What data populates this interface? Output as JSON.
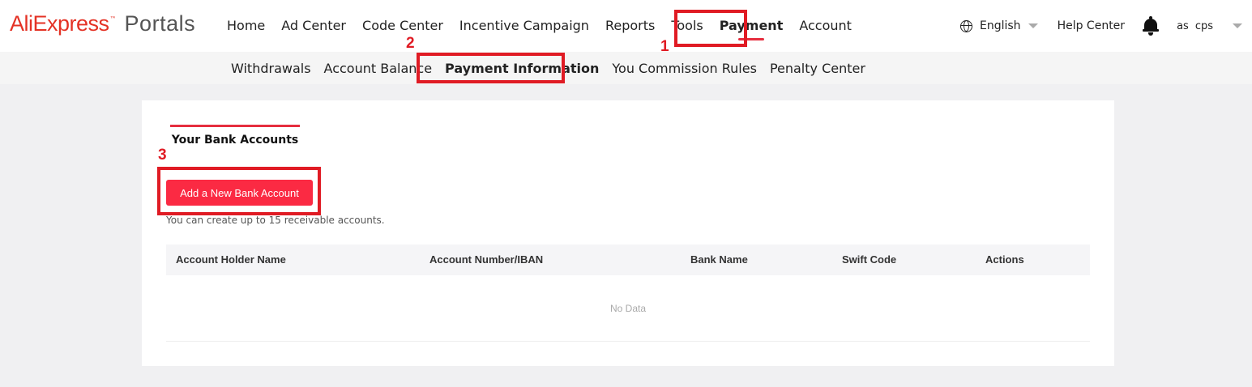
{
  "logo": {
    "brand": "AliExpress",
    "tm": "™",
    "product": "Portals"
  },
  "main_nav": [
    {
      "label": "Home"
    },
    {
      "label": "Ad Center"
    },
    {
      "label": "Code Center"
    },
    {
      "label": "Incentive Campaign"
    },
    {
      "label": "Reports"
    },
    {
      "label": "Tools"
    },
    {
      "label": "Payment",
      "active": true
    },
    {
      "label": "Account"
    }
  ],
  "right_nav": {
    "language": "English",
    "help": "Help Center",
    "user_first": "as",
    "user_last": "cps"
  },
  "sub_nav": [
    {
      "label": "Withdrawals"
    },
    {
      "label": "Account Balance"
    },
    {
      "label": "Payment Information",
      "active": true
    },
    {
      "label": "You Commission Rules"
    },
    {
      "label": "Penalty Center"
    }
  ],
  "annotations": {
    "step1": "1",
    "step2": "2",
    "step3": "3",
    "color": "#e01b24"
  },
  "content": {
    "tab_label": "Your Bank Accounts",
    "add_button": "Add a New Bank Account",
    "hint": "You can create up to 15 receivable accounts.",
    "columns": [
      "Account Holder Name",
      "Account Number/IBAN",
      "Bank Name",
      "Swift Code",
      "Actions"
    ],
    "empty_text": "No Data"
  },
  "colors": {
    "brand_red": "#e43225",
    "accent": "#fb2a43"
  }
}
